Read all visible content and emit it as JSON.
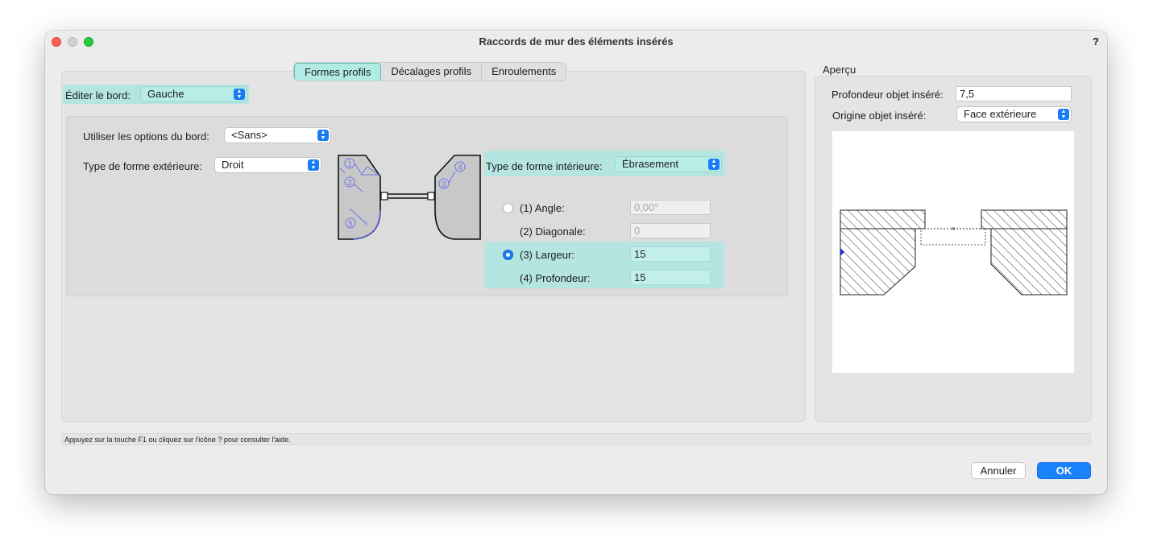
{
  "window": {
    "title": "Raccords de mur des éléments insérés",
    "help": "?"
  },
  "tabs": [
    {
      "label": "Formes profils",
      "active": true
    },
    {
      "label": "Décalages profils",
      "active": false
    },
    {
      "label": "Enroulements",
      "active": false
    }
  ],
  "edge": {
    "label": "Éditer le bord:",
    "value": "Gauche"
  },
  "options": {
    "label": "Utiliser les options du bord:",
    "value": "<Sans>"
  },
  "outer_shape": {
    "label": "Type de forme extérieure:",
    "value": "Droit"
  },
  "inner_shape": {
    "label": "Type de forme intérieure:",
    "value": "Ébrasement"
  },
  "diagram": {
    "markers": [
      "1",
      "2",
      "3",
      "4",
      "5"
    ]
  },
  "params": [
    {
      "label": "(1) Angle:",
      "value": "0,00°",
      "radio": "off",
      "disabled": true
    },
    {
      "label": "(2) Diagonale:",
      "value": "0",
      "radio": "none",
      "disabled": true
    },
    {
      "label": "(3) Largeur:",
      "value": "15",
      "radio": "on",
      "disabled": false
    },
    {
      "label": "(4) Profondeur:",
      "value": "15",
      "radio": "none",
      "disabled": false
    }
  ],
  "preview": {
    "section_title": "Aperçu",
    "depth_label": "Profondeur objet inséré:",
    "depth_value": "7,5",
    "origin_label": "Origine objet inséré:",
    "origin_value": "Face extérieure"
  },
  "status": "Appuyez sur la touche F1 ou cliquez sur l'icône ? pour consulter l'aide.",
  "buttons": {
    "cancel": "Annuler",
    "ok": "OK"
  },
  "colors": {
    "accent": "#1a82fb",
    "highlight": "#b4e5e0",
    "diagram_blue": "#6f74e8"
  }
}
